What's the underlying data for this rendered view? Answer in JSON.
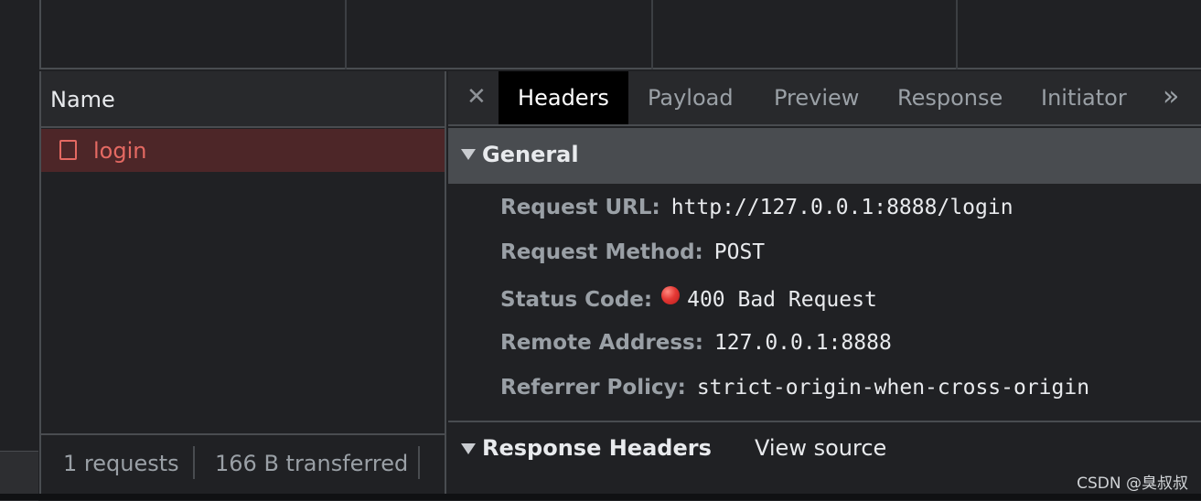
{
  "name_pane": {
    "header": "Name",
    "requests": [
      {
        "label": "login",
        "status": "error"
      }
    ],
    "footer": {
      "requests": "1 requests",
      "transferred": "166 B transferred"
    }
  },
  "tabs": [
    "Headers",
    "Payload",
    "Preview",
    "Response",
    "Initiator"
  ],
  "active_tab": "Headers",
  "general": {
    "title": "General",
    "rows": [
      {
        "key": "Request URL:",
        "value": "http://127.0.0.1:8888/login"
      },
      {
        "key": "Request Method:",
        "value": "POST"
      },
      {
        "key": "Status Code:",
        "value": "400 Bad Request"
      },
      {
        "key": "Remote Address:",
        "value": "127.0.0.1:8888"
      },
      {
        "key": "Referrer Policy:",
        "value": "strict-origin-when-cross-origin"
      }
    ]
  },
  "response_headers": {
    "title": "Response Headers",
    "view_source": "View source"
  },
  "watermark": "CSDN @臭叔叔",
  "icons": {
    "close": "close-icon",
    "more": "chevron-double-right-icon",
    "status": "red-dot-icon",
    "document": "document-icon"
  },
  "colors": {
    "error": "#e46962",
    "selected_row": "#4d2628",
    "active_tab_bg": "#000000"
  }
}
